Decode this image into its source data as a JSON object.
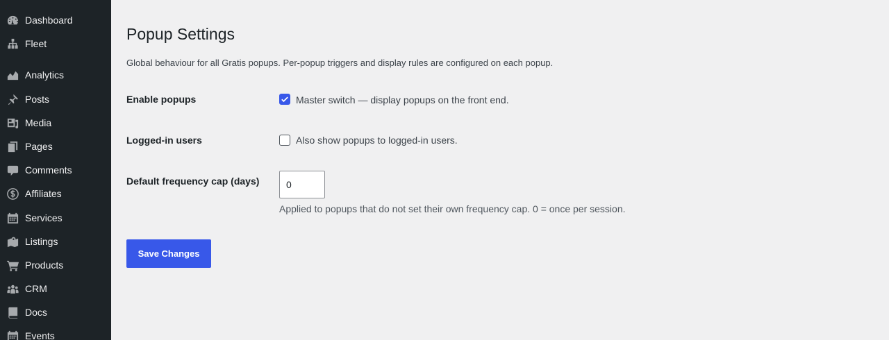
{
  "sidebar": {
    "items": [
      {
        "label": "Dashboard",
        "icon": "dashboard-icon"
      },
      {
        "label": "Fleet",
        "icon": "sitemap-icon"
      },
      {
        "label": "Analytics",
        "icon": "chart-area-icon"
      },
      {
        "label": "Posts",
        "icon": "pushpin-icon"
      },
      {
        "label": "Media",
        "icon": "media-icon"
      },
      {
        "label": "Pages",
        "icon": "pages-icon"
      },
      {
        "label": "Comments",
        "icon": "comment-icon"
      },
      {
        "label": "Affiliates",
        "icon": "money-icon"
      },
      {
        "label": "Services",
        "icon": "calendar-icon"
      },
      {
        "label": "Listings",
        "icon": "map-icon"
      },
      {
        "label": "Products",
        "icon": "cart-icon"
      },
      {
        "label": "CRM",
        "icon": "groups-icon"
      },
      {
        "label": "Docs",
        "icon": "book-icon"
      },
      {
        "label": "Events",
        "icon": "calendar-icon"
      }
    ],
    "colors": {
      "background": "#1d2327",
      "text": "#f0f0f1"
    }
  },
  "page": {
    "title": "Popup Settings",
    "description": "Global behaviour for all Gratis popups. Per-popup triggers and display rules are configured on each popup."
  },
  "settings": {
    "enable_popups": {
      "label": "Enable popups",
      "checked": true,
      "description": "Master switch — display popups on the front end."
    },
    "logged_in_users": {
      "label": "Logged-in users",
      "checked": false,
      "description": "Also show popups to logged-in users."
    },
    "frequency_cap": {
      "label": "Default frequency cap (days)",
      "value": "0",
      "help": "Applied to popups that do not set their own frequency cap. 0 = once per session."
    }
  },
  "actions": {
    "save_label": "Save Changes"
  },
  "colors": {
    "accent": "#3858e9",
    "page_background": "#f0f0f1"
  }
}
